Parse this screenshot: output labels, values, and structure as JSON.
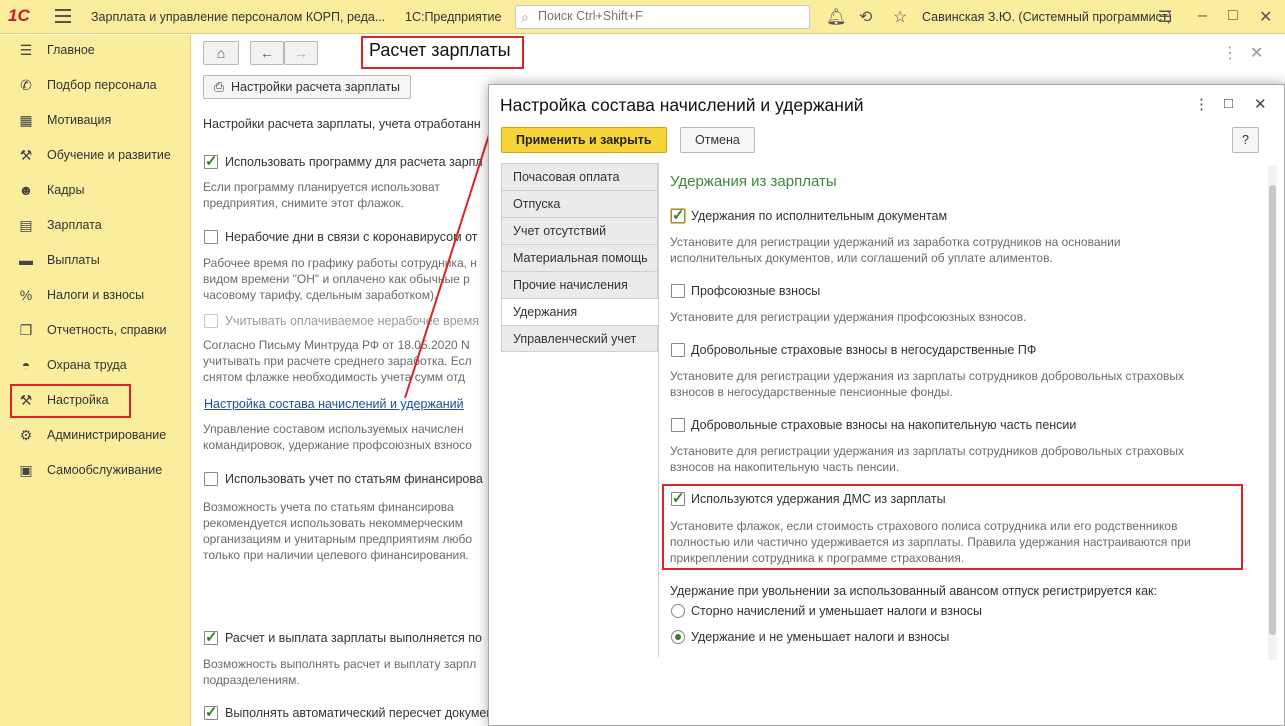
{
  "app": {
    "logo": "1С",
    "title": "Зарплата и управление персоналом КОРП, реда...",
    "platform": "1С:Предприятие",
    "search_placeholder": "Поиск Ctrl+Shift+F",
    "user": "Савинская З.Ю. (Системный программист)"
  },
  "sidebar": {
    "items": [
      {
        "label": "Главное",
        "icon": "menu-icon"
      },
      {
        "label": "Подбор персонала",
        "icon": "phone-icon"
      },
      {
        "label": "Мотивация",
        "icon": "gift-icon"
      },
      {
        "label": "Обучение и развитие",
        "icon": "wrench-icon"
      },
      {
        "label": "Кадры",
        "icon": "people-icon"
      },
      {
        "label": "Зарплата",
        "icon": "calculator-icon"
      },
      {
        "label": "Выплаты",
        "icon": "money-icon"
      },
      {
        "label": "Налоги и взносы",
        "icon": "percent-icon"
      },
      {
        "label": "Отчетность, справки",
        "icon": "report-icon"
      },
      {
        "label": "Охрана труда",
        "icon": "helmet-icon"
      },
      {
        "label": "Настройка",
        "icon": "wrench-icon"
      },
      {
        "label": "Администрирование",
        "icon": "gear-icon"
      },
      {
        "label": "Самообслуживание",
        "icon": "card-icon"
      }
    ]
  },
  "main": {
    "title": "Расчет зарплаты",
    "settings_button": "Настройки расчета зарплаты",
    "intro": "Настройки расчета зарплаты, учета отработанн",
    "opt1_label": "Использовать программу для расчета зарпл",
    "opt1_hint1": "Если программу планируется использоват",
    "opt1_hint2": "предприятия, снимите этот флажок.",
    "opt2_label": "Нерабочие дни в связи с коронавирусом от",
    "opt2_hint1": "Рабочее время по графику работы сотрудника, н",
    "opt2_hint2": "видом времени \"ОН\" и оплачено как обычные р",
    "opt2_hint3": "часовому тарифу, сдельным заработком).",
    "opt3_label": "Учитывать оплачиваемое нерабочее время",
    "opt3_hint1": "Согласно Письму Минтруда РФ от 18.05.2020 N",
    "opt3_hint2": "учитывать при расчете среднего заработка. Есл",
    "opt3_hint3": "снятом флажке необходимость учета сумм отд",
    "link": "Настройка состава начислений и удержаний",
    "link_hint1": "Управление составом используемых начислен",
    "link_hint2": "командировок, удержание профсоюзных взносо",
    "opt4_label": "Использовать учет по статьям финансирова",
    "opt4_hint1": "Возможность учета по статьям финансирова",
    "opt4_hint2": "рекомендуется использовать некоммерческим",
    "opt4_hint3": "организациям и унитарным предприятиям любо",
    "opt4_hint4": "только при наличии целевого финансирования.",
    "opt5_label": "Расчет и выплата зарплаты выполняется по",
    "opt5_hint1": "Возможность выполнять расчет и выплату зарпл",
    "opt5_hint2": "подразделениям.",
    "opt6_label": "Выполнять автоматический пересчет документов при их редактировании"
  },
  "dialog": {
    "title": "Настройка состава начислений и удержаний",
    "apply_button": "Применить и закрыть",
    "cancel_button": "Отмена",
    "help_button": "?",
    "tabs": [
      "Почасовая оплата",
      "Отпуска",
      "Учет отсутствий",
      "Материальная помощь",
      "Прочие начисления",
      "Удержания",
      "Управленческий учет"
    ],
    "section_title": "Удержания из зарплаты",
    "items": [
      {
        "label": "Удержания по исполнительным документам",
        "checked": true,
        "hint1": "Установите для регистрации удержаний из заработка сотрудников на основании",
        "hint2": "исполнительных документов, или соглашений об уплате алиментов."
      },
      {
        "label": "Профсоюзные взносы",
        "checked": false,
        "hint1": "Установите для регистрации удержания профсоюзных взносов.",
        "hint2": ""
      },
      {
        "label": "Добровольные страховые взносы в негосударственные ПФ",
        "checked": false,
        "hint1": "Установите для регистрации удержания из зарплаты сотрудников добровольных страховых",
        "hint2": "взносов в негосударственные пенсионные фонды."
      },
      {
        "label": "Добровольные страховые взносы на накопительную часть пенсии",
        "checked": false,
        "hint1": "Установите для регистрации удержания из зарплаты сотрудников добровольных страховых",
        "hint2": "взносов на накопительную часть пенсии."
      },
      {
        "label": "Используются удержания ДМС из зарплаты",
        "checked": true,
        "hint1": "Установите флажок, если стоимость страхового полиса сотрудника или его родственников",
        "hint2": "полностью или частично удерживается из зарплаты. Правила удержания настраиваются при",
        "hint3": "прикреплении сотрудника к программе страхования."
      }
    ],
    "radio_caption": "Удержание при увольнении за использованный авансом отпуск регистрируется как:",
    "radio1": "Сторно начислений и уменьшает налоги и взносы",
    "radio2": "Удержание и не уменьшает налоги и взносы"
  },
  "colors": {
    "accent": "#fbed9e",
    "highlight": "#d9252a",
    "section": "#3a8a3a"
  }
}
